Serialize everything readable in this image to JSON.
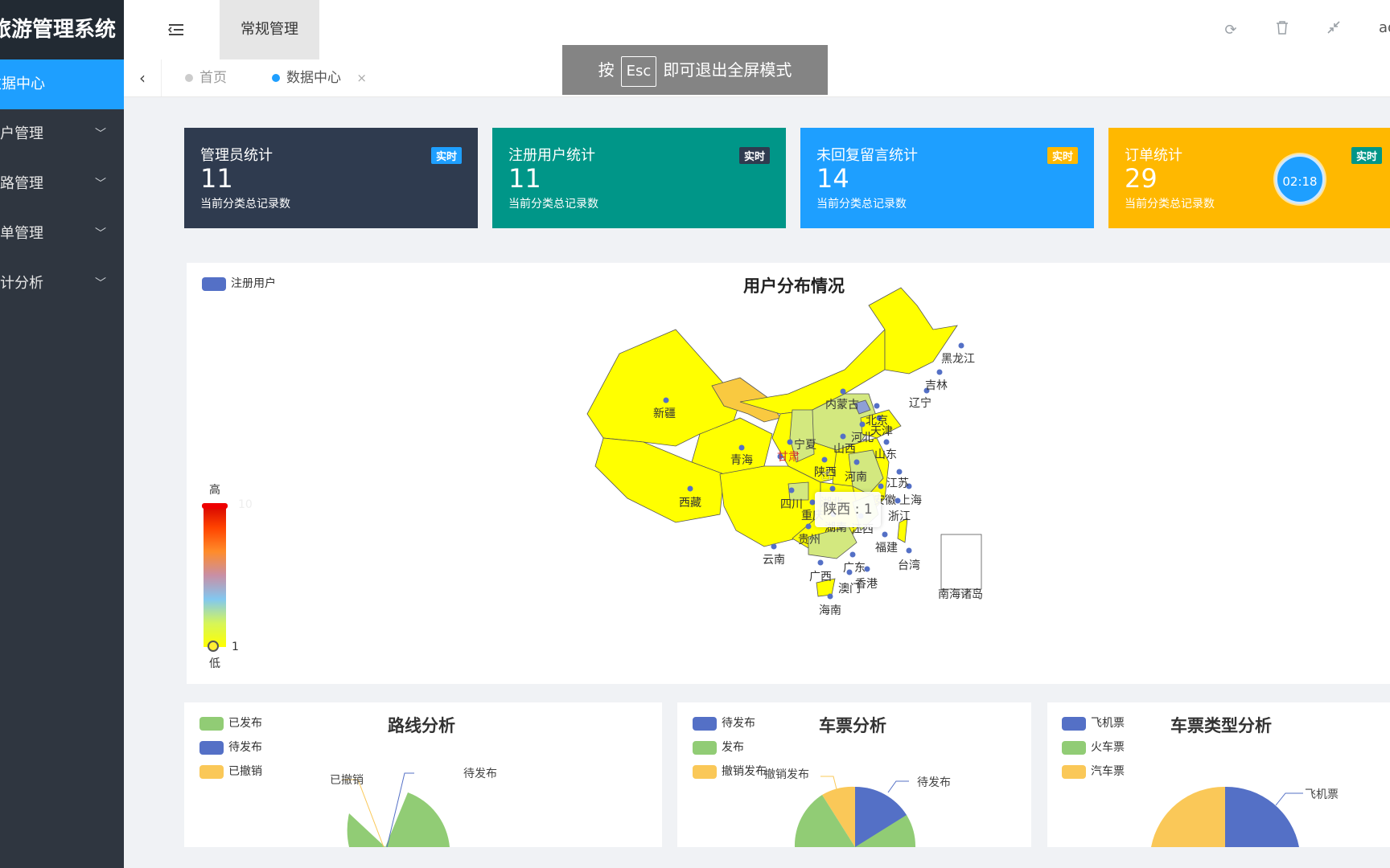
{
  "app": {
    "title": "旅游管理系统"
  },
  "sidebar": {
    "items": [
      {
        "label": "数据中心",
        "active": true
      },
      {
        "label": "用户管理"
      },
      {
        "label": "线路管理"
      },
      {
        "label": "订单管理"
      },
      {
        "label": "统计分析"
      }
    ]
  },
  "topbar": {
    "tab": "常规管理",
    "user": "admin"
  },
  "tabs": {
    "home": "首页",
    "current": "数据中心"
  },
  "esc": {
    "pre": "按",
    "key": "Esc",
    "post": "即可退出全屏模式"
  },
  "cards": [
    {
      "title": "管理员统计",
      "value": "11",
      "sub": "当前分类总记录数",
      "badge": "实时",
      "bg": "#2f3b4f",
      "badge_bg": "#1e9fff"
    },
    {
      "title": "注册用户统计",
      "value": "11",
      "sub": "当前分类总记录数",
      "badge": "实时",
      "bg": "#009688",
      "badge_bg": "#2f3b4f"
    },
    {
      "title": "未回复留言统计",
      "value": "14",
      "sub": "当前分类总记录数",
      "badge": "实时",
      "bg": "#1e9fff",
      "badge_bg": "#ffb800"
    },
    {
      "title": "订单统计",
      "value": "29",
      "sub": "当前分类总记录数",
      "badge": "实时",
      "bg": "#ffb800",
      "badge_bg": "#009688"
    }
  ],
  "timer": "02:18",
  "map": {
    "title": "用户分布情况",
    "legend": "注册用户",
    "visual_map": {
      "high": "高",
      "low": "低",
      "min": 1,
      "max": 10
    },
    "tooltip": "陕西 : 1",
    "provinces": [
      "黑龙江",
      "吉林",
      "辽宁",
      "内蒙古",
      "北京",
      "天津",
      "河北",
      "山西",
      "山东",
      "新疆",
      "宁夏",
      "甘肃",
      "青海",
      "陕西",
      "河南",
      "江苏",
      "西藏",
      "四川",
      "重庆",
      "湖北",
      "安徽",
      "上海",
      "浙江",
      "湖南",
      "江西",
      "贵州",
      "福建",
      "云南",
      "广西",
      "广东",
      "香港",
      "澳门",
      "台湾",
      "海南",
      "南海诸岛"
    ]
  },
  "charts": [
    {
      "title": "路线分析",
      "legend": [
        "已发布",
        "待发布",
        "已撤销"
      ],
      "labels": [
        "已撤销",
        "待发布"
      ],
      "colors": [
        "#91cc75",
        "#5470c6",
        "#fac858"
      ]
    },
    {
      "title": "车票分析",
      "legend": [
        "待发布",
        "发布",
        "撤销发布"
      ],
      "labels": [
        "撤销发布",
        "待发布"
      ],
      "colors": [
        "#5470c6",
        "#91cc75",
        "#fac858"
      ]
    },
    {
      "title": "车票类型分析",
      "legend": [
        "飞机票",
        "火车票",
        "汽车票"
      ],
      "labels": [
        "飞机票"
      ],
      "colors": [
        "#5470c6",
        "#91cc75",
        "#fac858"
      ]
    }
  ]
}
